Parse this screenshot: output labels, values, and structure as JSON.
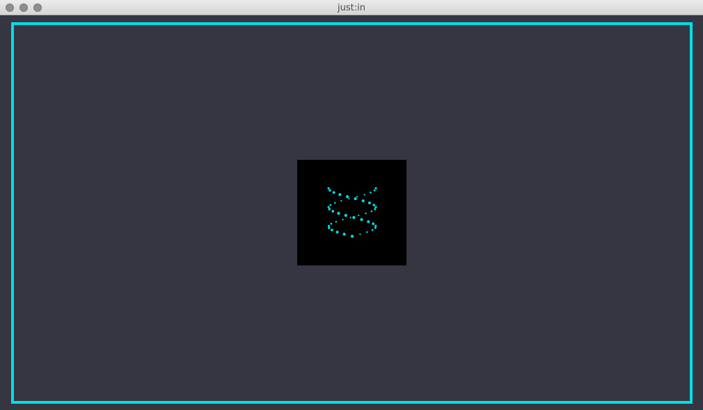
{
  "window": {
    "title": "just:in"
  },
  "colors": {
    "accent": "#00e0e8",
    "background": "#363642",
    "loader_bg": "#000000"
  },
  "loader": {
    "icon": "dna-helix-loading-icon"
  }
}
